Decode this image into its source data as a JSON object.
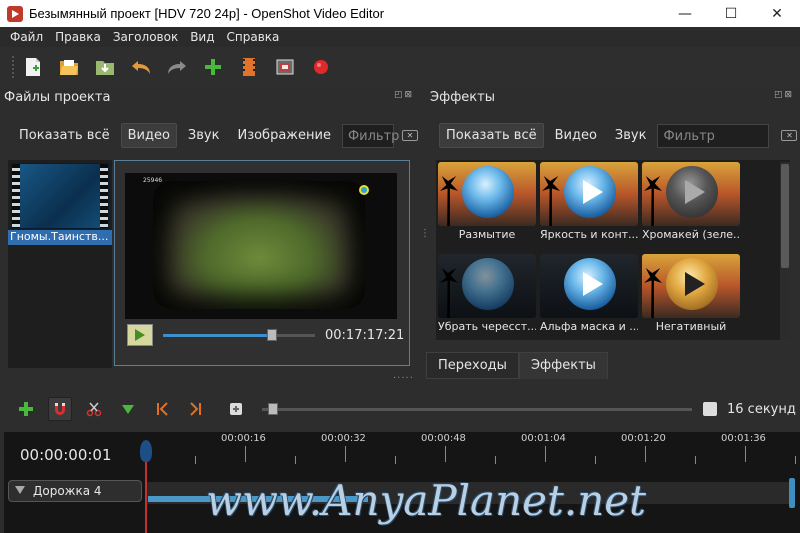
{
  "window": {
    "title": "Безымянный проект [HDV 720 24p] - OpenShot Video Editor",
    "minimize": "—",
    "maximize": "☐",
    "close": "✕"
  },
  "menu": [
    "Файл",
    "Правка",
    "Заголовок",
    "Вид",
    "Справка"
  ],
  "toolbar": {
    "icons": [
      "new-project-icon",
      "open-project-icon",
      "save-project-icon",
      "undo-icon",
      "redo-icon",
      "import-files-icon",
      "choose-profile-icon",
      "fullscreen-icon",
      "export-video-icon"
    ]
  },
  "project_files": {
    "title": "Файлы проекта",
    "filters": [
      "Показать всё",
      "Видео",
      "Звук",
      "Изображение"
    ],
    "active_filter": "Видео",
    "filter_placeholder": "Фильтр",
    "files": [
      {
        "label": "Гномы.Таинств..."
      }
    ]
  },
  "preview": {
    "frame_counter": "25946",
    "timecode": "00:17:17:21",
    "progress": 0.72
  },
  "effects": {
    "title": "Эффекты",
    "filters": [
      "Показать всё",
      "Видео",
      "Звук"
    ],
    "active_filter": "Показать всё",
    "filter_placeholder": "Фильтр",
    "items": [
      {
        "label": "Размытие",
        "style": "plain"
      },
      {
        "label": "Яркость и конт...",
        "style": "play"
      },
      {
        "label": "Хромакей (зеле...",
        "style": "dark"
      },
      {
        "label": "Убрать чересст...",
        "style": "plain"
      },
      {
        "label": "Альфа маска и ...",
        "style": "play"
      },
      {
        "label": "Негативный",
        "style": "neg"
      }
    ]
  },
  "tabs": [
    "Переходы",
    "Эффекты"
  ],
  "active_tab": "Эффекты",
  "timeline": {
    "zoom_label": "16 секунд",
    "current_time": "00:00:00:01",
    "ruler": [
      "00:00:16",
      "00:00:32",
      "00:00:48",
      "00:01:04",
      "00:01:20",
      "00:01:36"
    ],
    "tracks": [
      {
        "name": "Дорожка 4"
      }
    ],
    "toolbar_icons": [
      "add-track-icon",
      "snapping-icon",
      "razor-icon",
      "add-marker-icon",
      "previous-marker-icon",
      "next-marker-icon",
      "center-playhead-icon"
    ]
  },
  "watermark": "www.AnyaPlanet.net",
  "colors": {
    "accent": "#2f6dae",
    "playhead": "#c83030",
    "background": "#2d2d2d"
  }
}
